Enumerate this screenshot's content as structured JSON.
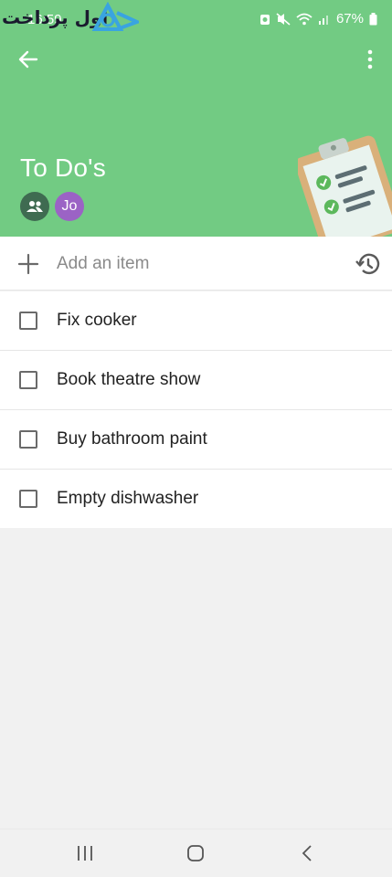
{
  "status_bar": {
    "time": "16:59",
    "battery": "67%",
    "watermark_text": "انتخاب اول در پرداخت های بین المللی"
  },
  "header": {
    "title": "To Do's",
    "members": [
      {
        "type": "group",
        "initials": ""
      },
      {
        "type": "user",
        "initials": "Jo"
      }
    ],
    "accent_color": "#72cb83"
  },
  "add_item": {
    "placeholder": "Add an item"
  },
  "tasks": [
    {
      "label": "Fix cooker",
      "checked": false
    },
    {
      "label": "Book theatre show",
      "checked": false
    },
    {
      "label": "Buy bathroom paint",
      "checked": false
    },
    {
      "label": "Empty dishwasher",
      "checked": false
    }
  ],
  "icons": {
    "back": "arrow-left-icon",
    "more": "more-vertical-icon",
    "add": "plus-icon",
    "history": "history-icon",
    "nav_recents": "recents-icon",
    "nav_home": "home-icon",
    "nav_back": "chevron-left-icon"
  }
}
